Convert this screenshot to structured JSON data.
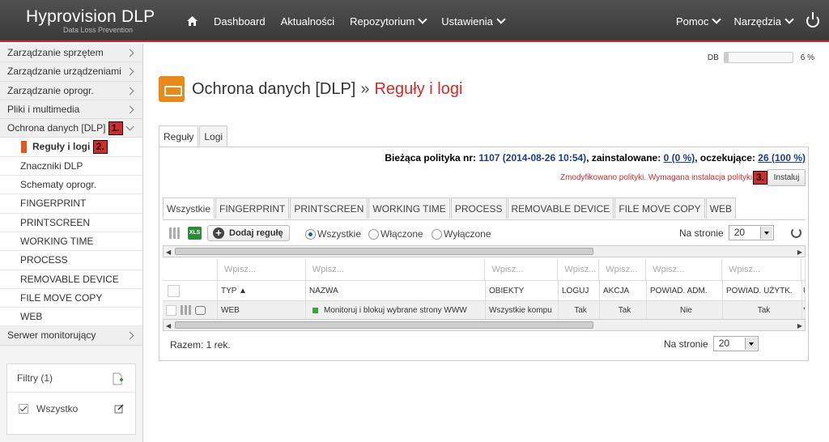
{
  "app": {
    "title": "Hyprovision DLP",
    "subtitle": "Data Loss Prevention"
  },
  "nav": {
    "items": [
      "Dashboard",
      "Aktualności",
      "Repozytorium",
      "Ustawienia"
    ],
    "right": [
      "Pomoc",
      "Narzędzia"
    ]
  },
  "sidebar": {
    "items": [
      "Zarządzanie sprzętem",
      "Zarządzanie urządzeniami",
      "Zarządzanie oprogr.",
      "Pliki i multimedia",
      "Ochrona danych [DLP]"
    ],
    "badge1": "1.",
    "sub": [
      "Reguły i logi",
      "Znaczniki DLP",
      "Schematy oprogr.",
      "FINGERPRINT",
      "PRINTSCREEN",
      "WORKING TIME",
      "PROCESS",
      "REMOVABLE DEVICE",
      "FILE MOVE COPY",
      "WEB"
    ],
    "badge2": "2.",
    "last": "Serwer monitorujący",
    "filters_title": "Filtry (1)",
    "filter_item": "Wszystko"
  },
  "db": {
    "label": "DB",
    "percent": "6 %",
    "fill": 0.06
  },
  "page": {
    "title": "Ochrona danych [DLP]",
    "sep": "»",
    "subtitle": "Reguły i logi"
  },
  "tabs": [
    "Reguły",
    "Logi"
  ],
  "policy": {
    "label": "Bieżąca polityka nr:",
    "value": "1107 (2014-08-26 10:54)",
    "installed_label": ", zainstalowane:",
    "installed": "0 (0 %)",
    "pending_label": ", oczekujące:",
    "pending": "26 (100 %)"
  },
  "warning": "Zmodyfikowano polityki. Wymagana instalacja polityki.",
  "badge3": "3.",
  "install_label": "Instaluj",
  "subtabs": [
    "Wszystkie",
    "FINGERPRINT",
    "PRINTSCREEN",
    "WORKING TIME",
    "PROCESS",
    "REMOVABLE DEVICE",
    "FILE MOVE COPY",
    "WEB"
  ],
  "toolbar": {
    "add_label": "Dodaj regułę",
    "xls": "XLS",
    "radios": [
      "Wszystkie",
      "Włączone",
      "Wyłączone"
    ],
    "per_page_label": "Na stronie",
    "per_page": "20"
  },
  "table": {
    "filter_placeholder": "Wpisz...",
    "headers": [
      "TYP ▲",
      "NAZWA",
      "OBIEKTY",
      "LOGUJ",
      "AKCJA",
      "POWIAD. ADM.",
      "POWIAD. UŻYTK.",
      "U"
    ],
    "row": [
      "WEB",
      "Monitoruj i blokuj wybrane strony WWW",
      "Wszystkie kompu",
      "Tak",
      "Tak",
      "Nie",
      "Tak",
      "*"
    ]
  },
  "footer": {
    "total": "Razem: 1 rek.",
    "per_page_label": "Na stronie",
    "per_page": "20"
  },
  "colors": {
    "accent": "#d42a2a",
    "topbar": "#444444",
    "icon": "#e8891a"
  }
}
